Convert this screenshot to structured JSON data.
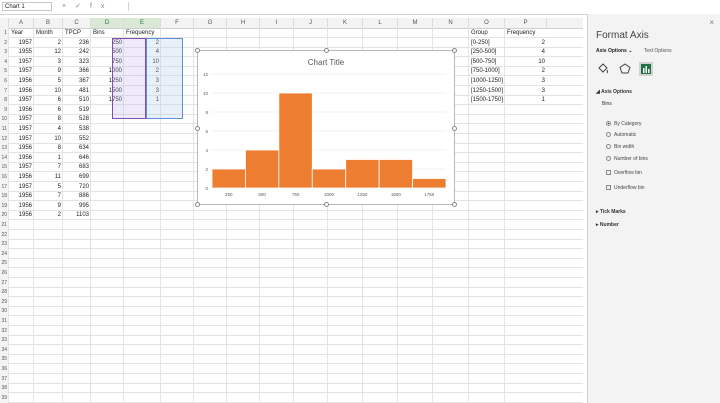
{
  "formula_bar": {
    "name_box": "Chart 1",
    "icons": [
      "cancel-icon",
      "enter-icon",
      "function-icon"
    ],
    "fx_label": "fx",
    "x_glyph": "×",
    "check_glyph": "✓"
  },
  "columns": [
    "A",
    "B",
    "C",
    "D",
    "E",
    "F",
    "G",
    "H",
    "I",
    "J",
    "K",
    "L",
    "M",
    "N",
    "O",
    "P"
  ],
  "rows": {
    "numbers": [
      "1",
      "2",
      "3",
      "4",
      "5",
      "6",
      "7",
      "8",
      "9",
      "10",
      "11",
      "12",
      "13",
      "14",
      "15",
      "16",
      "17",
      "18",
      "19",
      "20",
      "21",
      "22",
      "23",
      "24",
      "25",
      "26",
      "27",
      "28",
      "29",
      "30",
      "31",
      "32",
      "33",
      "34",
      "35",
      "36",
      "37",
      "38",
      "39"
    ],
    "header": [
      "Year",
      "Month",
      "TPCP",
      "Bins",
      "Frequency"
    ],
    "data": [
      [
        "1957",
        "2",
        "236",
        "250",
        "2"
      ],
      [
        "1955",
        "12",
        "242",
        "500",
        "4"
      ],
      [
        "1957",
        "3",
        "323",
        "750",
        "10"
      ],
      [
        "1957",
        "9",
        "366",
        "1000",
        "2"
      ],
      [
        "1956",
        "5",
        "367",
        "1250",
        "3"
      ],
      [
        "1956",
        "10",
        "481",
        "1500",
        "3"
      ],
      [
        "1957",
        "6",
        "510",
        "1750",
        "1"
      ],
      [
        "1956",
        "6",
        "519",
        "",
        ""
      ],
      [
        "1957",
        "8",
        "528",
        "",
        ""
      ],
      [
        "1957",
        "4",
        "538",
        "",
        ""
      ],
      [
        "1957",
        "10",
        "552",
        "",
        ""
      ],
      [
        "1956",
        "8",
        "634",
        "",
        ""
      ],
      [
        "1956",
        "1",
        "646",
        "",
        ""
      ],
      [
        "1957",
        "7",
        "683",
        "",
        ""
      ],
      [
        "1956",
        "11",
        "699",
        "",
        ""
      ],
      [
        "1957",
        "5",
        "720",
        "",
        ""
      ],
      [
        "1956",
        "7",
        "886",
        "",
        ""
      ],
      [
        "1956",
        "9",
        "995",
        "",
        ""
      ],
      [
        "1956",
        "2",
        "1103",
        "",
        ""
      ]
    ],
    "group_header": [
      "Group",
      "Frequency"
    ],
    "groups": [
      [
        "[0-250]",
        "2"
      ],
      [
        "[250-500]",
        "4"
      ],
      [
        "[500-750]",
        "10"
      ],
      [
        "[750-1000]",
        "2"
      ],
      [
        "[1000-1250]",
        "3"
      ],
      [
        "[1250-1500]",
        "3"
      ],
      [
        "[1500-1750]",
        "1"
      ]
    ]
  },
  "chart_data": {
    "type": "bar",
    "title": "Chart Title",
    "categories": [
      "250",
      "500",
      "750",
      "1000",
      "1250",
      "1500",
      "1750"
    ],
    "values": [
      2,
      4,
      10,
      2,
      3,
      3,
      1
    ],
    "ylim": [
      0,
      12
    ],
    "yticks": [
      "0",
      "2",
      "4",
      "6",
      "8",
      "10",
      "12"
    ],
    "xlabel": "",
    "ylabel": "",
    "bar_color": "#ed7d31",
    "grid": true,
    "legend": "none"
  },
  "panel": {
    "title": "Format Axis",
    "tabs": [
      "Axis Options",
      "Text Options"
    ],
    "tab_chevron": "⌄",
    "icons": [
      "fill-line-icon",
      "effects-icon",
      "axis-options-icon"
    ],
    "section_axis_options": "Axis Options",
    "bins_label": "Bins",
    "radios": [
      "By Category",
      "Automatic",
      "Bin width",
      "Number of bins"
    ],
    "checks": [
      "Overflow bin",
      "Underflow bin"
    ],
    "section_tick_marks": "Tick Marks",
    "section_number": "Number",
    "expanded_glyph": "◢",
    "collapsed_glyph": "▸",
    "close_glyph": "×"
  }
}
